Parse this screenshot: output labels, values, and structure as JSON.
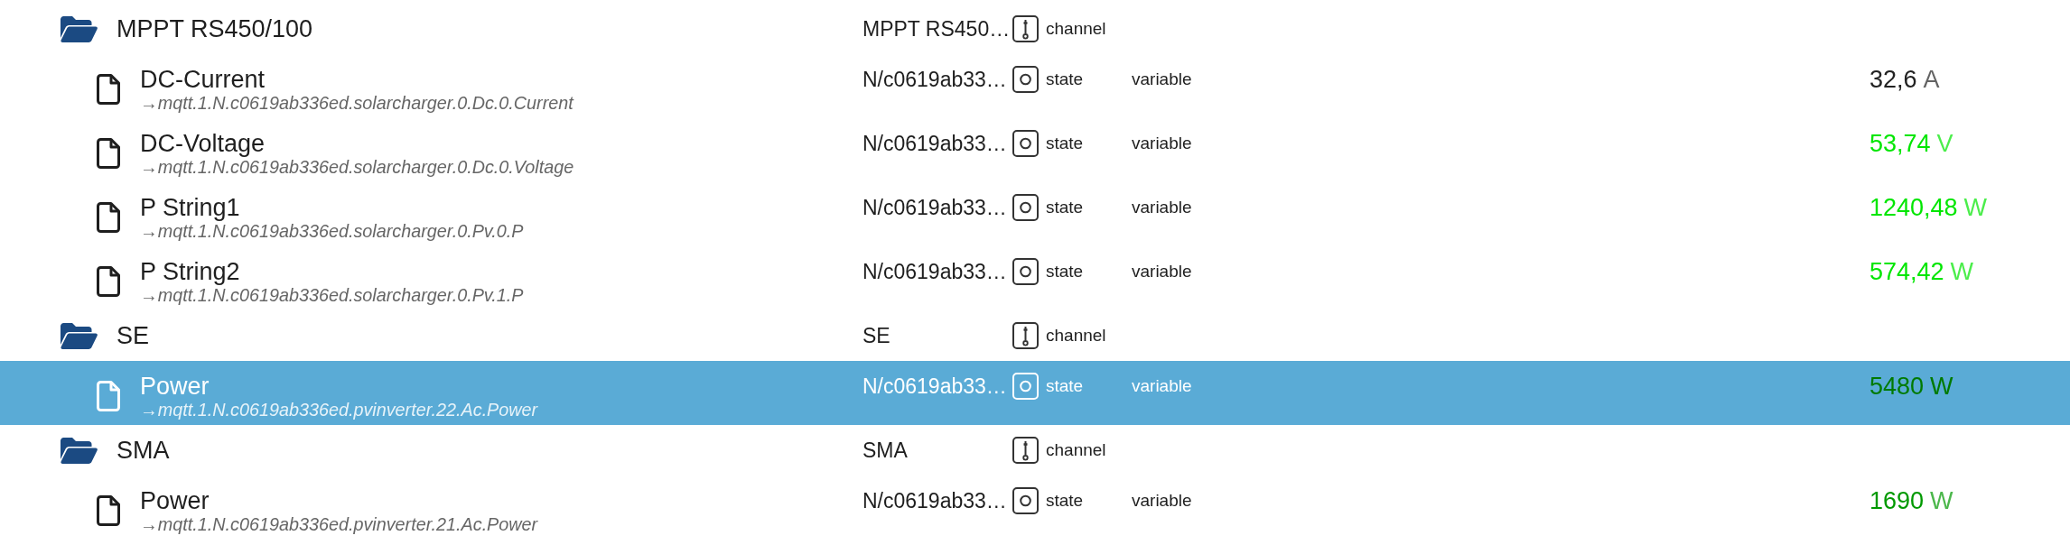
{
  "tree": [
    {
      "kind": "channel",
      "name": "MPPT RS450/100",
      "id": "MPPT RS450…",
      "type": "channel",
      "expanded": true,
      "selected": false,
      "children": [
        {
          "kind": "state",
          "name": "DC-Current",
          "path": "→mqtt.1.N.c0619ab336ed.solarcharger.0.Dc.0.Current",
          "id": "N/c0619ab33…",
          "type": "state",
          "role": "variable",
          "value": "32,6",
          "unit": "A",
          "color": "#222222",
          "selected": false
        },
        {
          "kind": "state",
          "name": "DC-Voltage",
          "path": "→mqtt.1.N.c0619ab336ed.solarcharger.0.Dc.0.Voltage",
          "id": "N/c0619ab33…",
          "type": "state",
          "role": "variable",
          "value": "53,74",
          "unit": "V",
          "color": "#00e600",
          "selected": false
        },
        {
          "kind": "state",
          "name": "P String1",
          "path": "→mqtt.1.N.c0619ab336ed.solarcharger.0.Pv.0.P",
          "id": "N/c0619ab33…",
          "type": "state",
          "role": "variable",
          "value": "1240,48",
          "unit": "W",
          "color": "#00e600",
          "selected": false
        },
        {
          "kind": "state",
          "name": "P String2",
          "path": "→mqtt.1.N.c0619ab336ed.solarcharger.0.Pv.1.P",
          "id": "N/c0619ab33…",
          "type": "state",
          "role": "variable",
          "value": "574,42",
          "unit": "W",
          "color": "#00e600",
          "selected": false
        }
      ]
    },
    {
      "kind": "channel",
      "name": "SE",
      "id": "SE",
      "type": "channel",
      "expanded": true,
      "selected": false,
      "children": [
        {
          "kind": "state",
          "name": "Power",
          "path": "→mqtt.1.N.c0619ab336ed.pvinverter.22.Ac.Power",
          "id": "N/c0619ab33…",
          "type": "state",
          "role": "variable",
          "value": "5480",
          "unit": "W",
          "color": "#007a00",
          "selected": true
        }
      ]
    },
    {
      "kind": "channel",
      "name": "SMA",
      "id": "SMA",
      "type": "channel",
      "expanded": true,
      "selected": false,
      "children": [
        {
          "kind": "state",
          "name": "Power",
          "path": "→mqtt.1.N.c0619ab336ed.pvinverter.21.Ac.Power",
          "id": "N/c0619ab33…",
          "type": "state",
          "role": "variable",
          "value": "1690",
          "unit": "W",
          "color": "#009900",
          "selected": false
        }
      ]
    }
  ]
}
